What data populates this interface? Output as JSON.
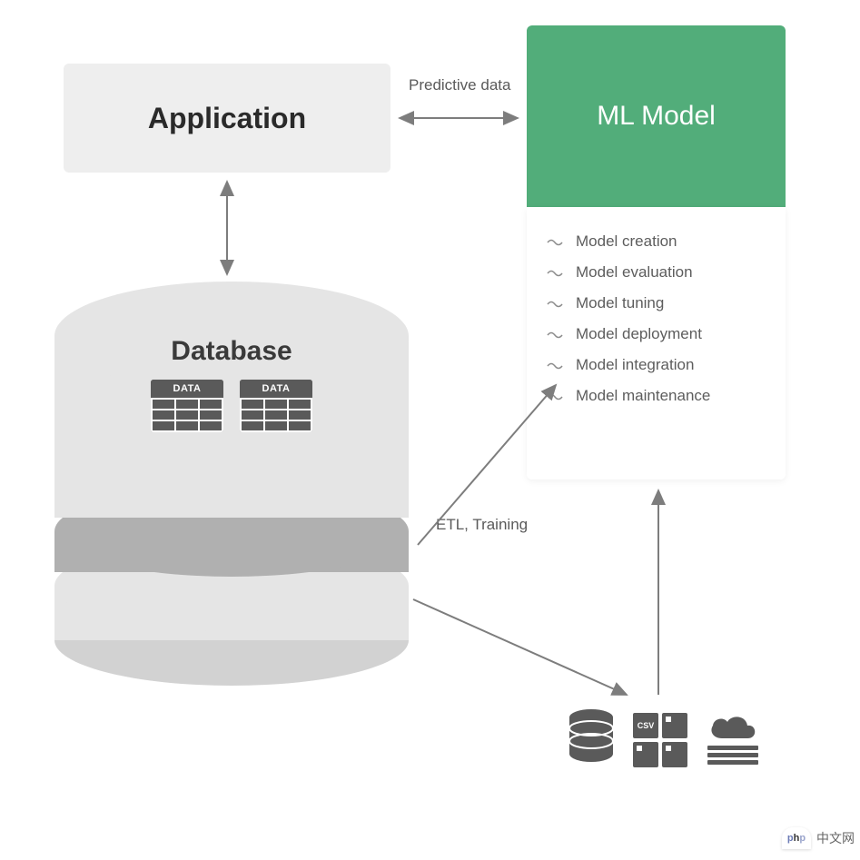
{
  "diagram": {
    "application": {
      "label": "Application"
    },
    "database": {
      "label": "Database",
      "table_label": "DATA"
    },
    "ml_model": {
      "label": "ML Model",
      "steps": [
        "Model creation",
        "Model evaluation",
        "Model tuning",
        "Model deployment",
        "Model integration",
        "Model maintenance"
      ]
    },
    "arrows": {
      "app_to_ml": "Predictive data",
      "db_to_ml": "ETL, Training"
    },
    "sources": {
      "csv_label": "CSV"
    }
  },
  "watermark": {
    "logo_text": "php",
    "text": "中文网"
  }
}
